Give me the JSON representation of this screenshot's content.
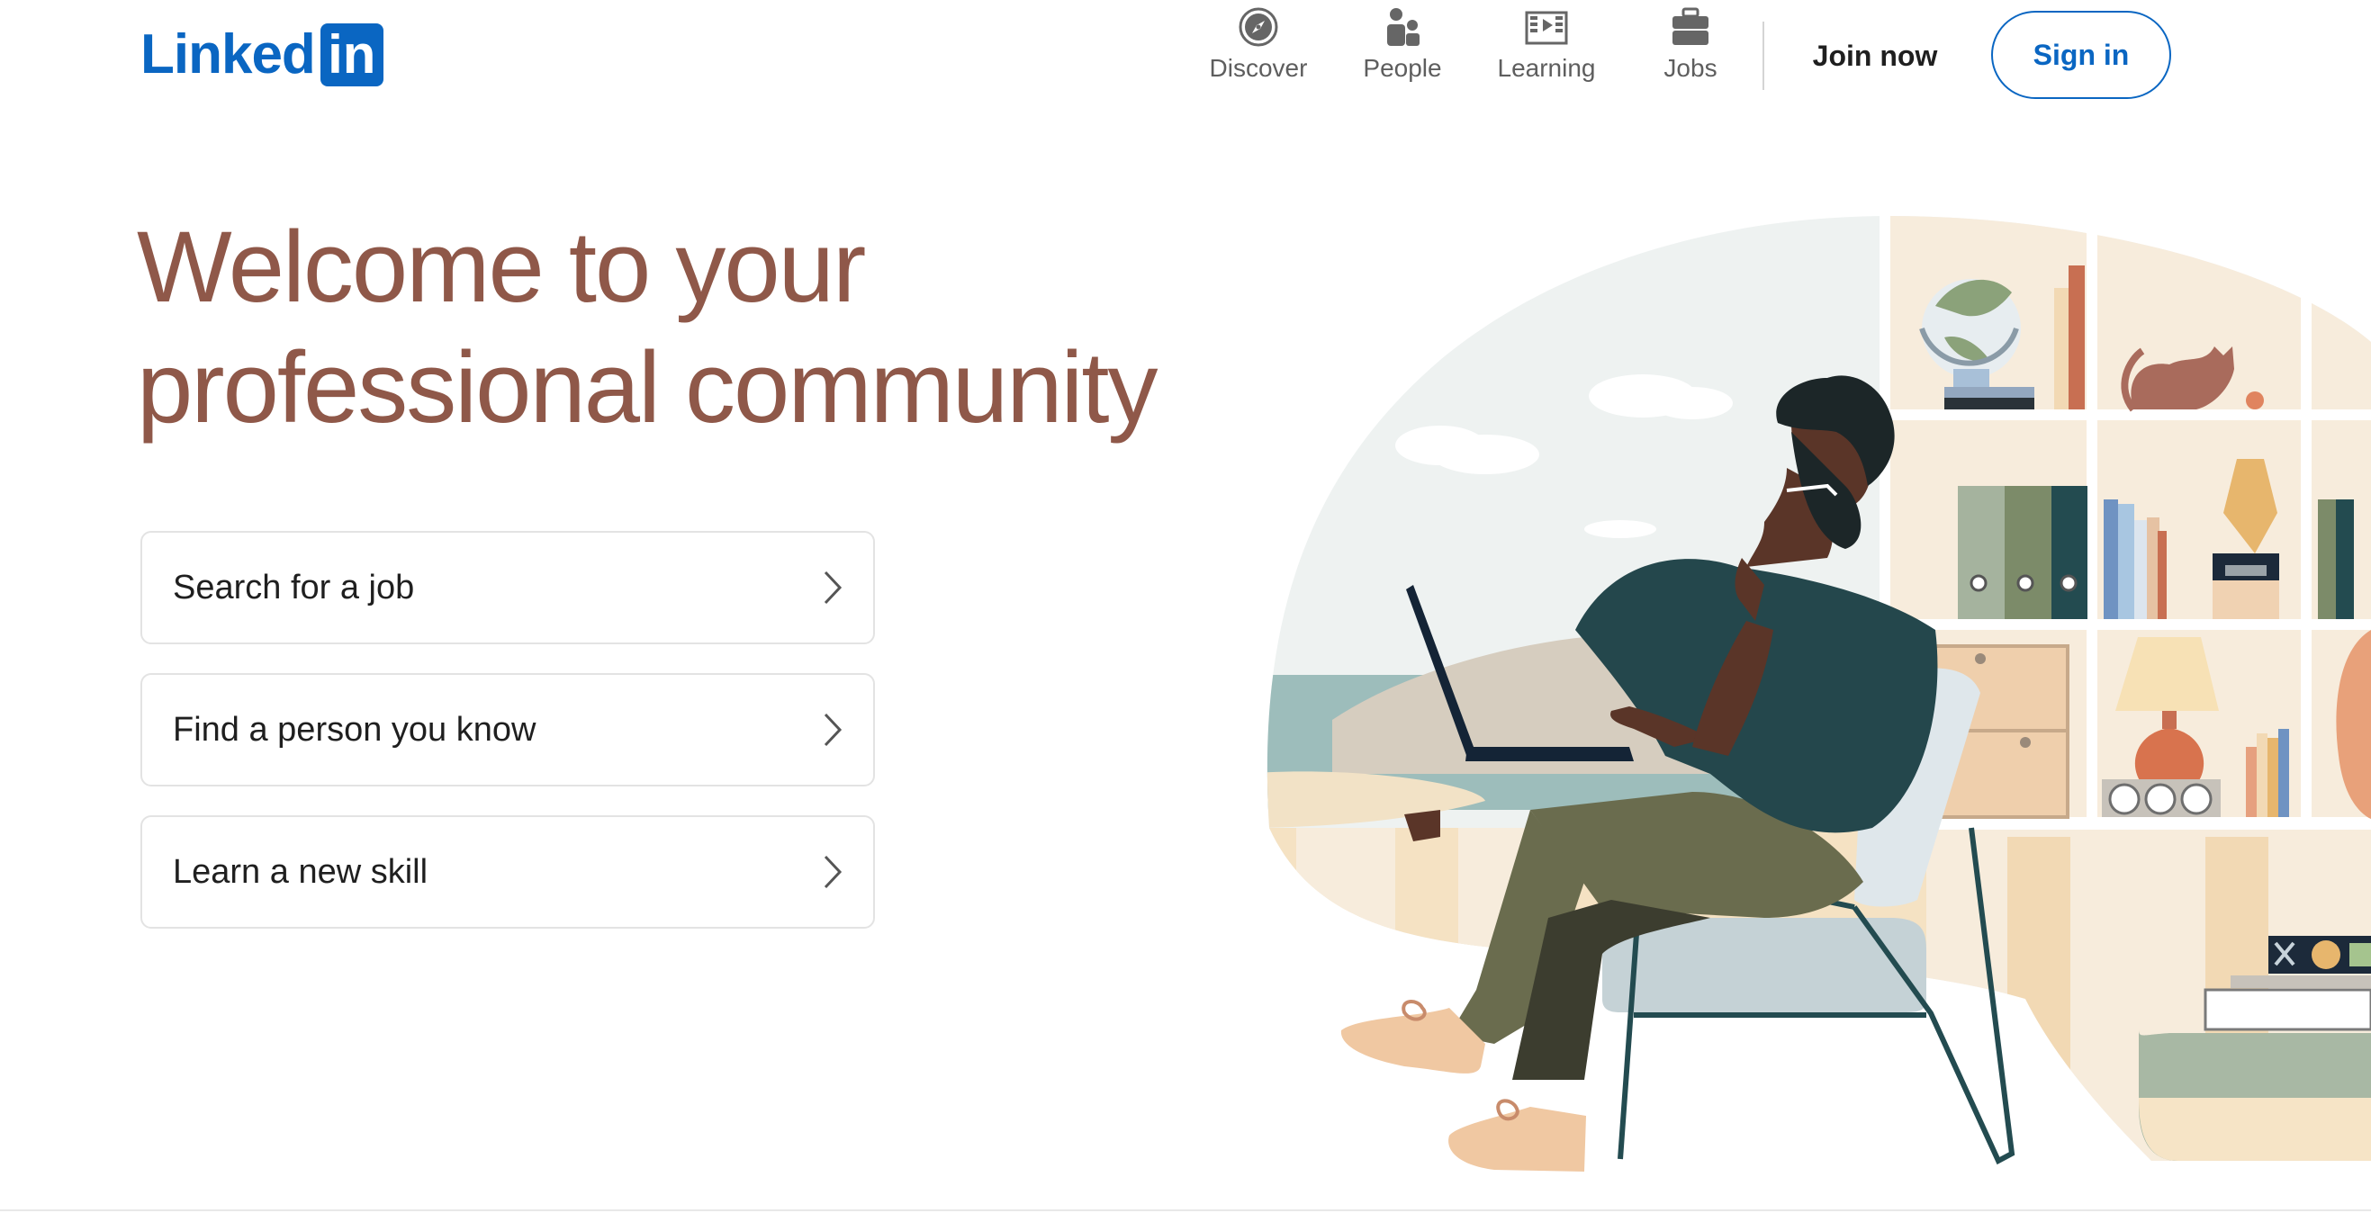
{
  "brand": {
    "logo_word": "Linked",
    "logo_box": "in",
    "color": "#0a66c2"
  },
  "nav": {
    "items": [
      {
        "label": "Discover",
        "icon": "compass-icon"
      },
      {
        "label": "People",
        "icon": "people-icon"
      },
      {
        "label": "Learning",
        "icon": "learning-video-icon"
      },
      {
        "label": "Jobs",
        "icon": "briefcase-icon"
      }
    ],
    "join_label": "Join now",
    "signin_label": "Sign in"
  },
  "hero": {
    "title_line1": "Welcome to your",
    "title_line2": "professional community",
    "title_color": "#8f5849"
  },
  "actions": [
    {
      "label": "Search for a job",
      "icon": "chevron-right-icon"
    },
    {
      "label": "Find a person you know",
      "icon": "chevron-right-icon"
    },
    {
      "label": "Learn a new skill",
      "icon": "chevron-right-icon"
    }
  ],
  "illustration": {
    "name": "hero-illustration"
  }
}
